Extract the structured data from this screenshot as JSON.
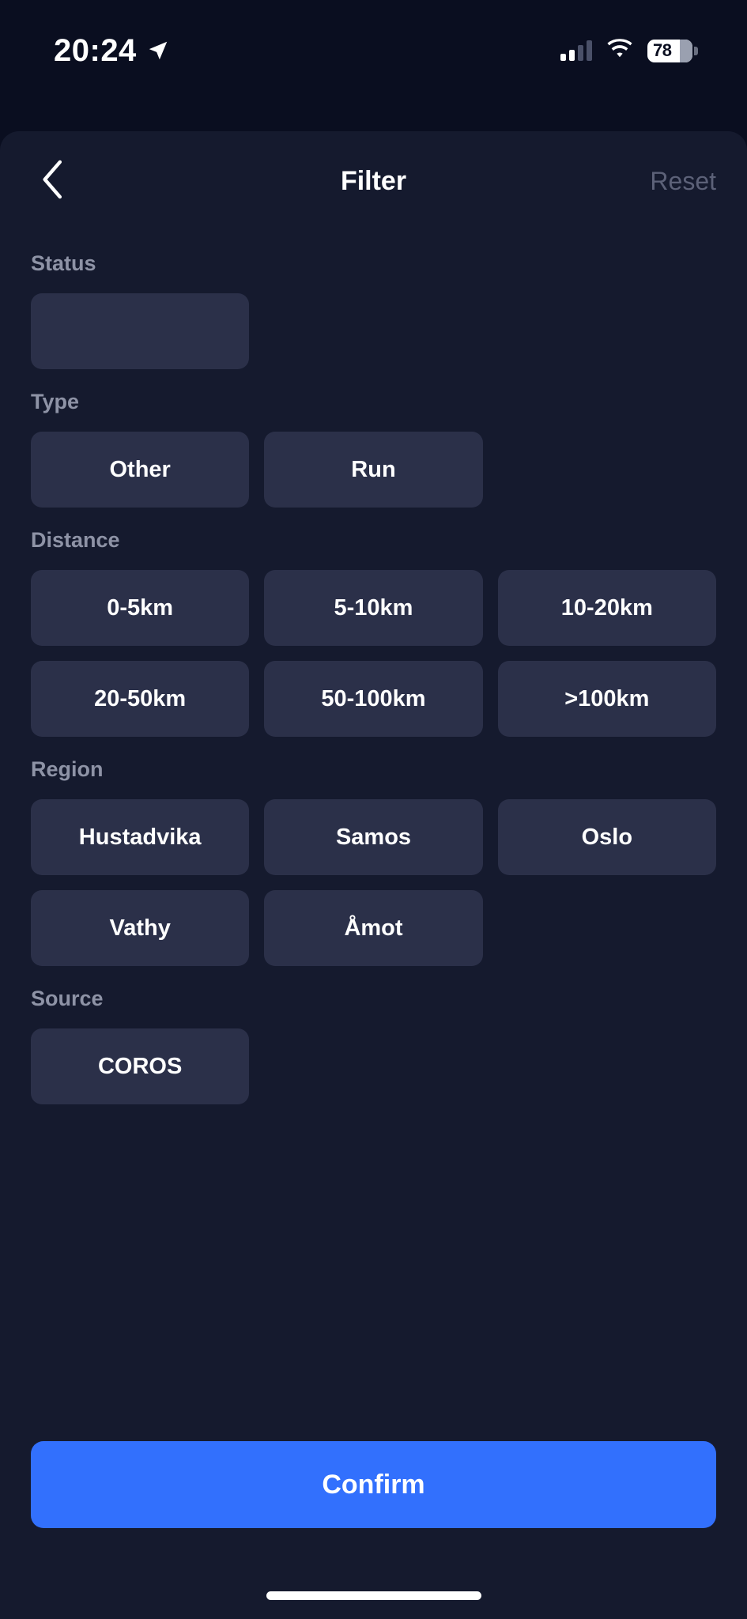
{
  "status_bar": {
    "time": "20:24",
    "location_icon": "location-arrow-icon",
    "cellular_icon": "cellular-signal-icon",
    "wifi_icon": "wifi-icon",
    "battery_percent": "78"
  },
  "header": {
    "back_icon": "chevron-left-icon",
    "title": "Filter",
    "reset_label": "Reset"
  },
  "sections": [
    {
      "label": "Status",
      "options": [
        ""
      ]
    },
    {
      "label": "Type",
      "options": [
        "Other",
        "Run"
      ]
    },
    {
      "label": "Distance",
      "options": [
        "0-5km",
        "5-10km",
        "10-20km",
        "20-50km",
        "50-100km",
        ">100km"
      ]
    },
    {
      "label": "Region",
      "options": [
        "Hustadvika",
        "Samos",
        "Oslo",
        "Vathy",
        "Åmot"
      ]
    },
    {
      "label": "Source",
      "options": [
        "COROS"
      ]
    }
  ],
  "footer": {
    "confirm_label": "Confirm"
  },
  "colors": {
    "page_background": "#0a0e20",
    "sheet_background": "#151a2e",
    "chip_background": "#2b3049",
    "accent": "#3270fd",
    "section_label": "#8e93a6",
    "reset_disabled": "#5c6178"
  }
}
